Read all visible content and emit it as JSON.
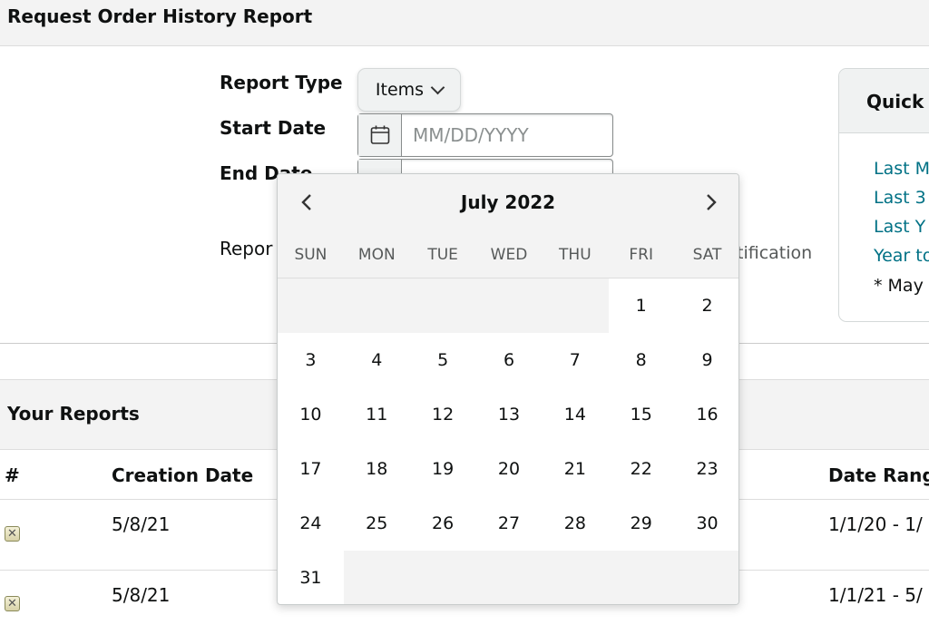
{
  "page_title": "Request Order History Report",
  "form": {
    "report_type_label": "Report Type",
    "report_type_value": "Items",
    "start_date_label": "Start Date",
    "start_date_placeholder": "MM/DD/YYYY",
    "end_date_label": "End Date",
    "report_label_partial": "Repor",
    "notification_partial": "tification"
  },
  "quick_select": {
    "title": "Quick S",
    "links": [
      "Last M",
      "Last 3",
      "Last Y",
      "Year to"
    ],
    "note": "* May"
  },
  "reports": {
    "title": "Your Reports",
    "columns": [
      "#",
      "Creation Date",
      "Date Range"
    ],
    "rows": [
      {
        "creation_date": "5/8/21",
        "date_range": "1/1/20 - 1/"
      },
      {
        "creation_date": "5/8/21",
        "date_range": "1/1/21 - 5/"
      }
    ]
  },
  "calendar": {
    "month_label": "July 2022",
    "weekdays": [
      "SUN",
      "MON",
      "TUE",
      "WED",
      "THU",
      "FRI",
      "SAT"
    ],
    "first_weekday": 5,
    "days_in_month": 31,
    "days": [
      "1",
      "2",
      "3",
      "4",
      "5",
      "6",
      "7",
      "8",
      "9",
      "10",
      "11",
      "12",
      "13",
      "14",
      "15",
      "16",
      "17",
      "18",
      "19",
      "20",
      "21",
      "22",
      "23",
      "24",
      "25",
      "26",
      "27",
      "28",
      "29",
      "30",
      "31"
    ]
  },
  "icons": {
    "calendar": "calendar-icon",
    "prev": "chevron-left-icon",
    "next": "chevron-right-icon",
    "dropdown": "chevron-down-icon",
    "delete": "delete-x-icon"
  },
  "colors": {
    "link": "#007185",
    "header_bg": "#f3f3f3",
    "text": "#0f1111"
  }
}
